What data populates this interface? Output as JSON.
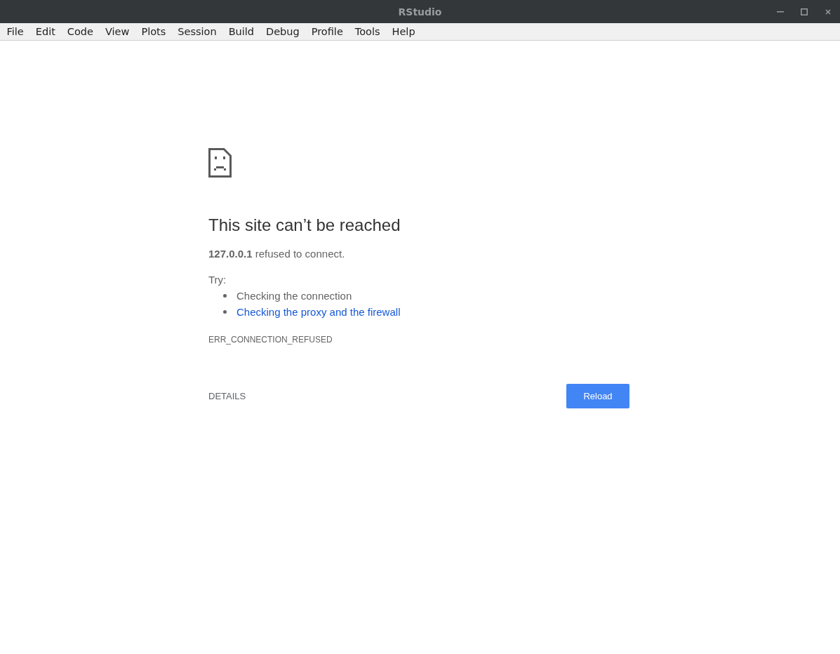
{
  "window": {
    "title": "RStudio"
  },
  "menu": [
    "File",
    "Edit",
    "Code",
    "View",
    "Plots",
    "Session",
    "Build",
    "Debug",
    "Profile",
    "Tools",
    "Help"
  ],
  "error_page": {
    "heading": "This site can’t be reached",
    "message": "**127.0.0.1** refused to connect.",
    "try_label": "Try:",
    "suggestions": [
      {
        "text": "Checking the connection",
        "kind": "text"
      },
      {
        "text": "Checking the proxy and the firewall",
        "kind": "link"
      }
    ],
    "error_code": "ERR_CONNECTION_REFUSED",
    "details_button": "DETAILS",
    "reload_button": "Reload"
  }
}
